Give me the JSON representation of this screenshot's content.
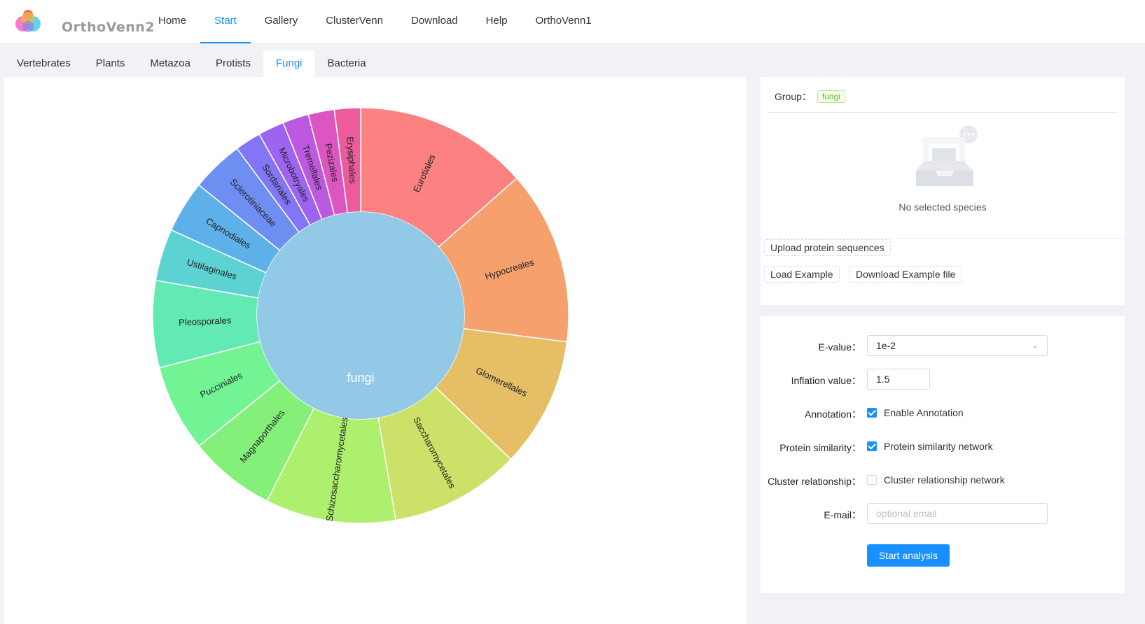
{
  "header": {
    "logo_text": "OrthoVenn2",
    "nav": [
      {
        "label": "Home",
        "active": false
      },
      {
        "label": "Start",
        "active": true
      },
      {
        "label": "Gallery",
        "active": false
      },
      {
        "label": "ClusterVenn",
        "active": false
      },
      {
        "label": "Download",
        "active": false
      },
      {
        "label": "Help",
        "active": false
      },
      {
        "label": "OrthoVenn1",
        "active": false
      }
    ]
  },
  "tabs": [
    {
      "label": "Vertebrates",
      "active": false
    },
    {
      "label": "Plants",
      "active": false
    },
    {
      "label": "Metazoa",
      "active": false
    },
    {
      "label": "Protists",
      "active": false
    },
    {
      "label": "Fungi",
      "active": true
    },
    {
      "label": "Bacteria",
      "active": false
    }
  ],
  "chart_data": {
    "type": "pie",
    "center_label": "fungi",
    "center_color": "#91c9e6",
    "categories": [
      "Eurotiales",
      "Hypocreales",
      "Glomerellales",
      "Saccharomycetales",
      "Schizosaccharomycetales",
      "Magnaporthales",
      "Pucciniales",
      "Pleosporales",
      "Ustilaginales",
      "Capnodiales",
      "Sclerotiniaceae",
      "Sordariales",
      "Microbotryales",
      "Tremellales",
      "Pezizales",
      "Erysiphales"
    ],
    "values": [
      2,
      2,
      1.5,
      1.5,
      1.5,
      1,
      1,
      1,
      0.6,
      0.6,
      0.6,
      0.3,
      0.3,
      0.3,
      0.3,
      0.3
    ],
    "colors": [
      "#fc8181",
      "#f6a06e",
      "#e5be66",
      "#cce167",
      "#adf06d",
      "#84f07a",
      "#72f494",
      "#62e9b4",
      "#5cd3d2",
      "#5eb1e8",
      "#6e8ff1",
      "#8376f4",
      "#9d64f0",
      "#bd58e1",
      "#dc56c1",
      "#ec5c9b"
    ]
  },
  "group": {
    "label": "Group：",
    "tag": "fungi",
    "empty_text": "No selected species"
  },
  "buttons": {
    "upload": "Upload protein sequences",
    "load_example": "Load Example",
    "download_example": "Download Example file"
  },
  "form": {
    "evalue_label": "E-value：",
    "evalue": "1e-2",
    "inflation_label": "Inflation value：",
    "inflation": "1.5",
    "annotation_label": "Annotation：",
    "annotation_option": "Enable Annotation",
    "annotation_checked": true,
    "similarity_label": "Protein similarity：",
    "similarity_option": "Protein similarity network",
    "similarity_checked": true,
    "cluster_label": "Cluster relationship：",
    "cluster_option": "Cluster relationship network",
    "cluster_checked": false,
    "email_label": "E-mail：",
    "email_placeholder": "optional email",
    "email_value": "",
    "submit": "Start analysis",
    "primary_color": "#1890ff"
  }
}
